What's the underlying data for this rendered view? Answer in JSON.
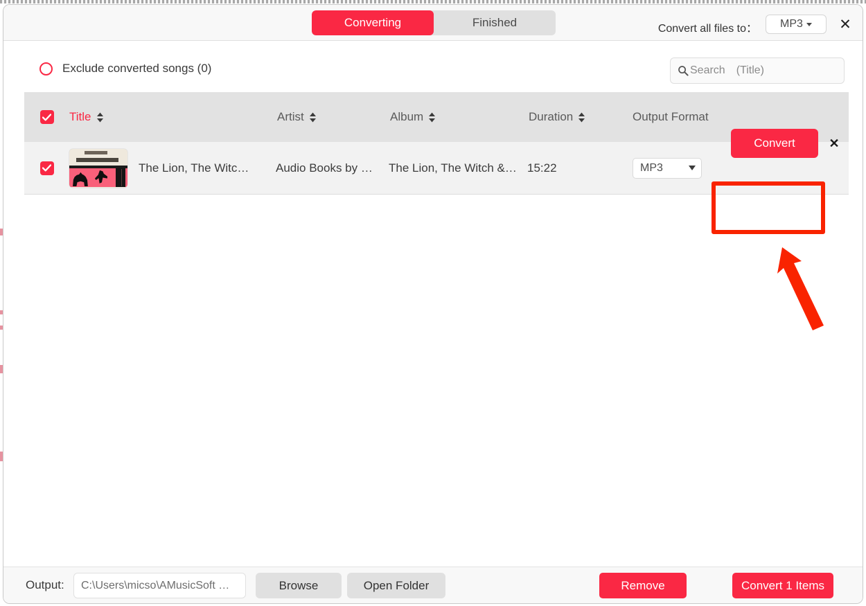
{
  "header": {
    "tabs": [
      {
        "label": "Converting",
        "active": true
      },
      {
        "label": "Finished",
        "active": false
      }
    ],
    "convert_all_label": "Convert all files to：",
    "convert_all_format": "MP3",
    "close_label": "✕"
  },
  "toolbar": {
    "exclude_label": "Exclude converted songs (0)",
    "search_placeholder": "Search (Title)",
    "search_value": ""
  },
  "table": {
    "columns": [
      {
        "key": "title",
        "label": "Title",
        "sortable": true
      },
      {
        "key": "artist",
        "label": "Artist",
        "sortable": true
      },
      {
        "key": "album",
        "label": "Album",
        "sortable": true
      },
      {
        "key": "duration",
        "label": "Duration",
        "sortable": true
      },
      {
        "key": "output_format",
        "label": "Output Format",
        "sortable": false
      }
    ],
    "rows": [
      {
        "checked": true,
        "title": "The Lion, The Witc…",
        "artist": "Audio Books by …",
        "album": "The Lion, The Witch &…",
        "duration": "15:22",
        "output_format": "MP3",
        "convert_label": "Convert",
        "remove_label": "✕"
      }
    ]
  },
  "footer": {
    "output_label": "Output:",
    "output_path": "C:\\Users\\micso\\AMusicSoft …",
    "browse_label": "Browse",
    "open_folder_label": "Open Folder",
    "remove_label": "Remove",
    "convert_items_label": "Convert 1 Items"
  },
  "colors": {
    "accent_red": "#fa2844",
    "annotation_red": "#f92300",
    "tab_inactive_bg": "#e0e0e0",
    "table_header_bg": "#e2e2e2",
    "table_row_bg": "#f2f2f2"
  }
}
